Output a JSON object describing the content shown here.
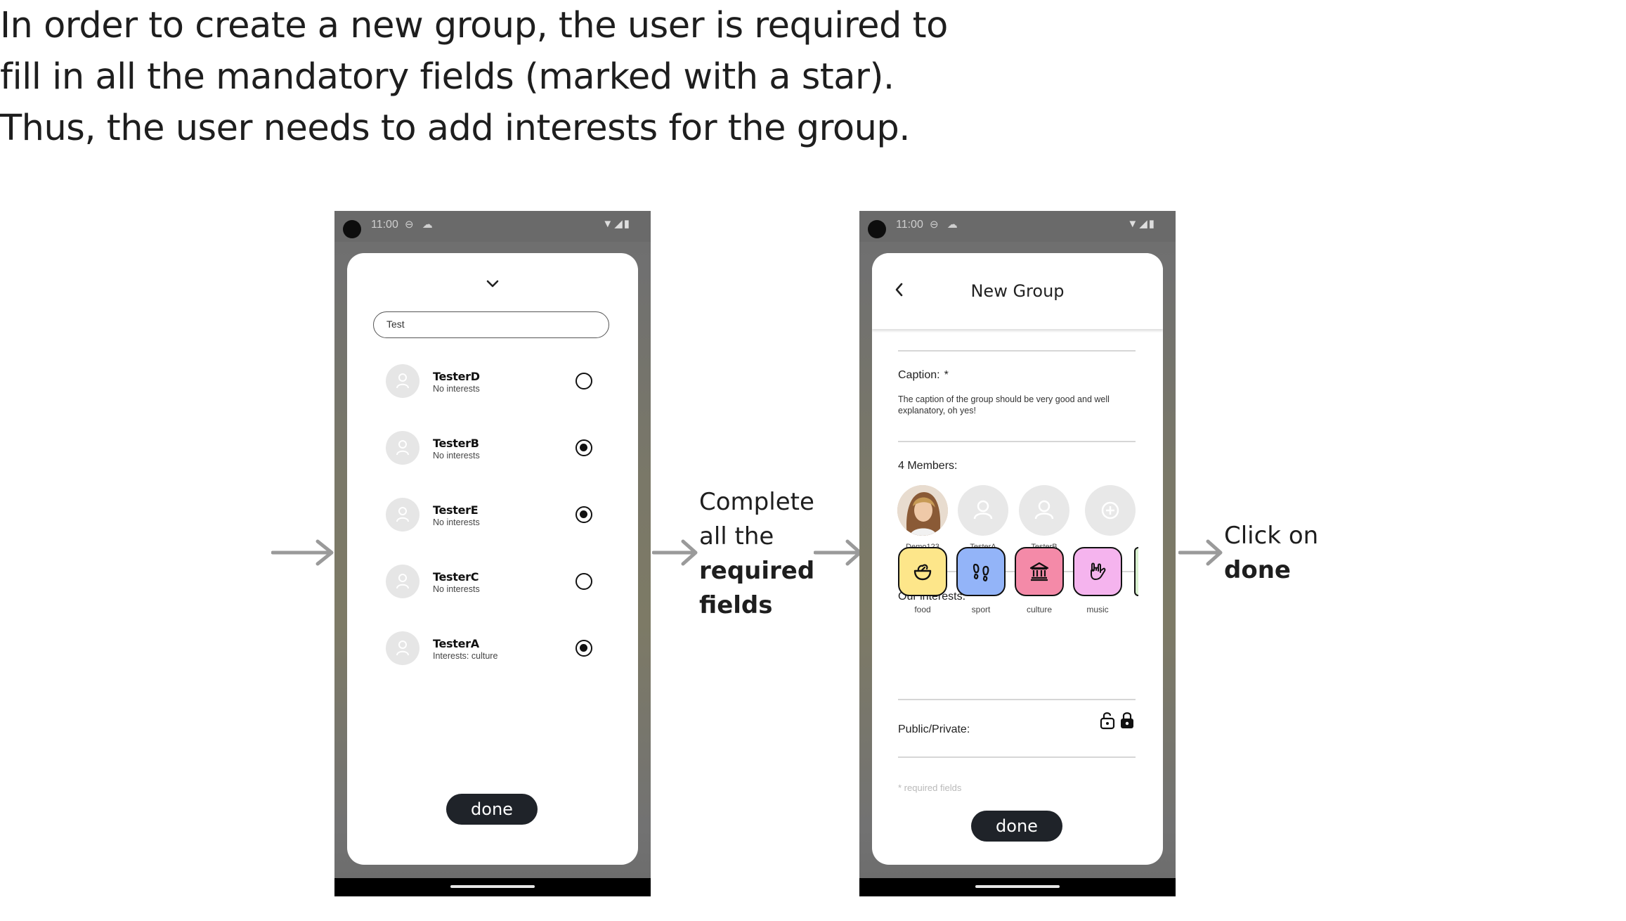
{
  "intro": {
    "line1": "In order to create a new group, the user is required to",
    "line2": "fill in all the mandatory fields (marked with a star).",
    "line3": "Thus, the user needs to add interests for the group."
  },
  "status_bar": {
    "time": "11:00"
  },
  "phone1": {
    "search_value": "Test",
    "users": [
      {
        "name": "TesterD",
        "subtitle": "No interests",
        "selected": false
      },
      {
        "name": "TesterB",
        "subtitle": "No interests",
        "selected": true
      },
      {
        "name": "TesterE",
        "subtitle": "No interests",
        "selected": true
      },
      {
        "name": "TesterC",
        "subtitle": "No interests",
        "selected": false
      },
      {
        "name": "TesterA",
        "subtitle": "Interests: culture",
        "selected": true
      }
    ],
    "done_label": "done"
  },
  "middle_caption": {
    "line1": "Complete",
    "line2": "all the",
    "line3": "required",
    "line4": "fields"
  },
  "phone2": {
    "title": "New Group",
    "caption_label": "Caption:",
    "caption_star": "*",
    "caption_text": "The caption of the group should be very good and well explanatory, oh yes!",
    "members_label": "4 Members:",
    "members": [
      {
        "name": "Demo123"
      },
      {
        "name": "TesterA"
      },
      {
        "name": "TesterB"
      }
    ],
    "interests_label": "Our interests:",
    "interests_star": "*",
    "interests": [
      {
        "name": "food",
        "color": "#fde68a",
        "icon": "food-bowl-icon"
      },
      {
        "name": "sport",
        "color": "#93b4f8",
        "icon": "footprints-icon"
      },
      {
        "name": "culture",
        "color": "#f48aa8",
        "icon": "museum-icon"
      },
      {
        "name": "music",
        "color": "#f5b4ee",
        "icon": "rock-hand-icon"
      }
    ],
    "privacy_label": "Public/Private:",
    "required_note": "* required fields",
    "done_label": "done"
  },
  "right_caption": {
    "line1": "Click on",
    "line2": "done"
  }
}
